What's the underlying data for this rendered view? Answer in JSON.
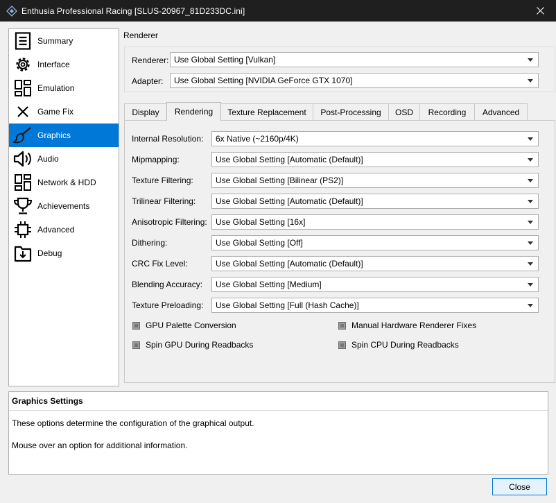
{
  "window": {
    "title": "Enthusia Professional Racing [SLUS-20967_81D233DC.ini]"
  },
  "sidebar": {
    "items": [
      {
        "label": "Summary",
        "icon": "summary-icon"
      },
      {
        "label": "Interface",
        "icon": "gear-icon"
      },
      {
        "label": "Emulation",
        "icon": "dashboard-icon"
      },
      {
        "label": "Game Fix",
        "icon": "close-x-icon"
      },
      {
        "label": "Graphics",
        "icon": "brush-icon",
        "active": true
      },
      {
        "label": "Audio",
        "icon": "speaker-icon"
      },
      {
        "label": "Network & HDD",
        "icon": "network-icon"
      },
      {
        "label": "Achievements",
        "icon": "trophy-icon"
      },
      {
        "label": "Advanced",
        "icon": "advanced-icon"
      },
      {
        "label": "Debug",
        "icon": "debug-icon"
      }
    ]
  },
  "renderer_section": {
    "title": "Renderer",
    "renderer_label": "Renderer:",
    "renderer_value": "Use Global Setting [Vulkan]",
    "adapter_label": "Adapter:",
    "adapter_value": "Use Global Setting [NVIDIA GeForce GTX 1070]"
  },
  "tabs": [
    {
      "label": "Display"
    },
    {
      "label": "Rendering",
      "active": true
    },
    {
      "label": "Texture Replacement"
    },
    {
      "label": "Post-Processing"
    },
    {
      "label": "OSD"
    },
    {
      "label": "Recording"
    },
    {
      "label": "Advanced"
    }
  ],
  "settings": [
    {
      "label": "Internal Resolution:",
      "value": "6x Native (~2160p/4K)"
    },
    {
      "label": "Mipmapping:",
      "value": "Use Global Setting [Automatic (Default)]"
    },
    {
      "label": "Texture Filtering:",
      "value": "Use Global Setting [Bilinear (PS2)]"
    },
    {
      "label": "Trilinear Filtering:",
      "value": "Use Global Setting [Automatic (Default)]"
    },
    {
      "label": "Anisotropic Filtering:",
      "value": "Use Global Setting [16x]"
    },
    {
      "label": "Dithering:",
      "value": "Use Global Setting [Off]"
    },
    {
      "label": "CRC Fix Level:",
      "value": "Use Global Setting [Automatic (Default)]"
    },
    {
      "label": "Blending Accuracy:",
      "value": "Use Global Setting [Medium]"
    },
    {
      "label": "Texture Preloading:",
      "value": "Use Global Setting [Full (Hash Cache)]"
    }
  ],
  "checkboxes": [
    {
      "label": "GPU Palette Conversion"
    },
    {
      "label": "Manual Hardware Renderer Fixes"
    },
    {
      "label": "Spin GPU During Readbacks"
    },
    {
      "label": "Spin CPU During Readbacks"
    }
  ],
  "description": {
    "title": "Graphics Settings",
    "line1": "These options determine the configuration of the graphical output.",
    "line2": "Mouse over an option for additional information."
  },
  "buttons": {
    "close": "Close"
  },
  "colors": {
    "accent": "#0078d7",
    "titlebar": "#1f1f1f"
  }
}
